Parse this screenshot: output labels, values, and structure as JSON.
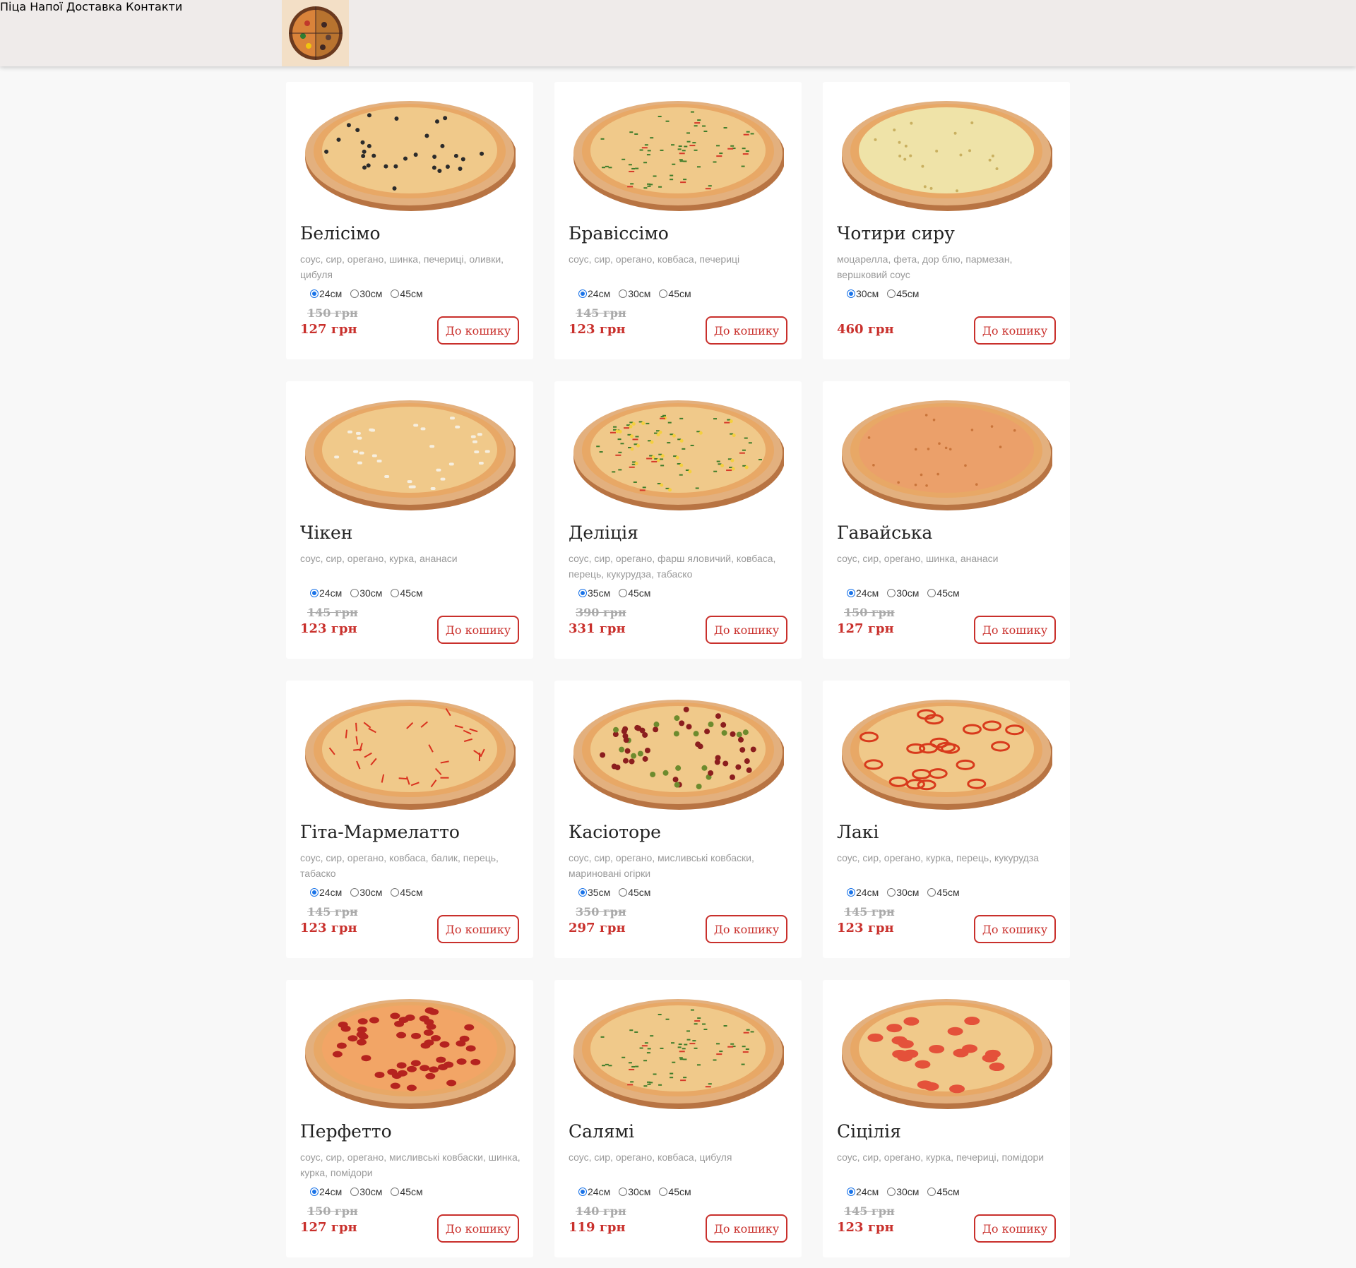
{
  "nav": {
    "items": [
      "Піца",
      "Напої",
      "Доставка",
      "Контакти"
    ]
  },
  "colors": {
    "accent": "#c9302c",
    "header_bg": "#efebea",
    "radio_checked": "#1a73e8"
  },
  "products": [
    {
      "name": "Белісімо",
      "desc": "соус, сир, орегано, шинка, печериці, оливки, цибуля",
      "sizes": [
        "24см",
        "30см",
        "45см"
      ],
      "selected": 0,
      "old_price": "150 грн",
      "price": "127 грн",
      "cart": "До кошику",
      "topping": "olives"
    },
    {
      "name": "Бравіссімо",
      "desc": "соус, сир, орегано, ковбаса, печериці",
      "sizes": [
        "24см",
        "30см",
        "45см"
      ],
      "selected": 0,
      "old_price": "145 грн",
      "price": "123 грн",
      "cart": "До кошику",
      "topping": "herbs"
    },
    {
      "name": "Чотири сиру",
      "desc": "моцарелла, фета, дор блю, пармезан, вершковий соус",
      "sizes": [
        "30см",
        "45см"
      ],
      "selected": 0,
      "old_price": "",
      "price": "460 грн",
      "cart": "До кошику",
      "topping": "cheese"
    },
    {
      "name": "Чікен",
      "desc": "соус, сир, орегано, курка, ананаси",
      "sizes": [
        "24см",
        "30см",
        "45см"
      ],
      "selected": 0,
      "old_price": "145 грн",
      "price": "123 грн",
      "cart": "До кошику",
      "topping": "chicken"
    },
    {
      "name": "Деліція",
      "desc": "соус, сир, орегано, фарш яловичий, ковбаса, перець, кукурудза, табаско",
      "sizes": [
        "35см",
        "45см"
      ],
      "selected": 0,
      "old_price": "390 грн",
      "price": "331 грн",
      "cart": "До кошику",
      "topping": "corn"
    },
    {
      "name": "Гавайська",
      "desc": "соус, сир, орегано, шинка, ананаси",
      "sizes": [
        "24см",
        "30см",
        "45см"
      ],
      "selected": 0,
      "old_price": "150 грн",
      "price": "127 грн",
      "cart": "До кошику",
      "topping": "plain"
    },
    {
      "name": "Гіта-Мармелатто",
      "desc": "соус, сир, орегано, ковбаса, балик, перець, табаско",
      "sizes": [
        "24см",
        "30см",
        "45см"
      ],
      "selected": 0,
      "old_price": "145 грн",
      "price": "123 грн",
      "cart": "До кошику",
      "topping": "peppers"
    },
    {
      "name": "Касіоторе",
      "desc": "соус, сир, орегано, мисливські ковбаски, мариновані огірки",
      "sizes": [
        "35см",
        "45см"
      ],
      "selected": 0,
      "old_price": "350 грн",
      "price": "297 грн",
      "cart": "До кошику",
      "topping": "sausage"
    },
    {
      "name": "Лакі",
      "desc": "соус, сир, орегано, курка, перець, кукурудза",
      "sizes": [
        "24см",
        "30см",
        "45см"
      ],
      "selected": 0,
      "old_price": "145 грн",
      "price": "123 грн",
      "cart": "До кошику",
      "topping": "rings"
    },
    {
      "name": "Перфетто",
      "desc": "соус, сир, орегано, мисливські ковбаски, шинка, курка, помідори",
      "sizes": [
        "24см",
        "30см",
        "45см"
      ],
      "selected": 0,
      "old_price": "150 грн",
      "price": "127 грн",
      "cart": "До кошику",
      "topping": "pepperoni"
    },
    {
      "name": "Салямі",
      "desc": "соус, сир, орегано, ковбаса, цибуля",
      "sizes": [
        "24см",
        "30см",
        "45см"
      ],
      "selected": 0,
      "old_price": "140 грн",
      "price": "119 грн",
      "cart": "До кошику",
      "topping": "herbs"
    },
    {
      "name": "Сіцілія",
      "desc": "соус, сир, орегано, курка, печериці, помідори",
      "sizes": [
        "24см",
        "30см",
        "45см"
      ],
      "selected": 0,
      "old_price": "145 грн",
      "price": "123 грн",
      "cart": "До кошику",
      "topping": "tomato"
    }
  ]
}
